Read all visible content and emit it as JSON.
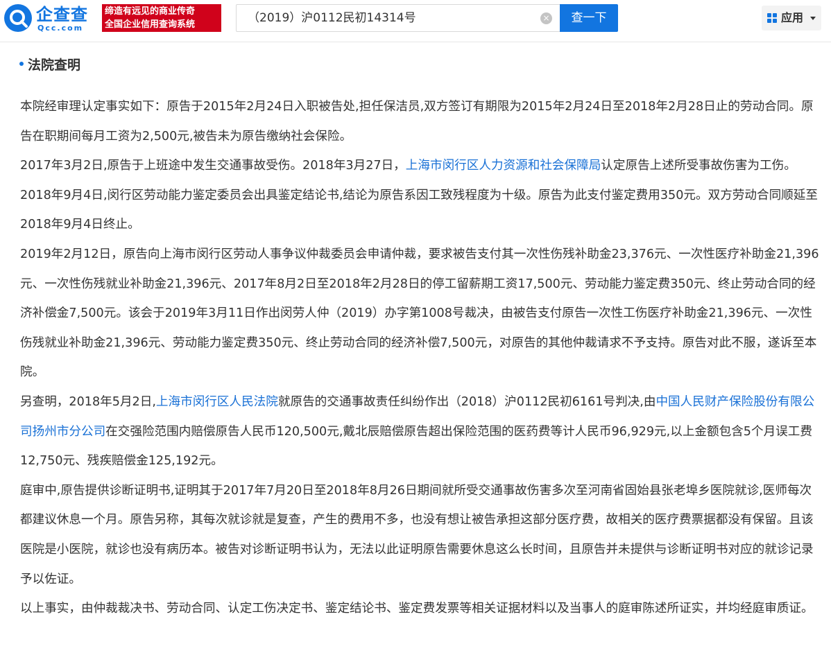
{
  "header": {
    "logo_text": "企查查",
    "logo_subtext": "Qcc.com",
    "slogan_line1": "缔造有远见的商业传奇",
    "slogan_line2": "全国企业信用查询系统",
    "search_value": "（2019）沪0112民初14314号",
    "search_button": "查一下",
    "apps_label": "应用",
    "colors": {
      "brand_blue": "#1275e0",
      "slogan_red": "#d0021b",
      "link_blue": "#1a71d6"
    }
  },
  "section": {
    "title": "法院查明"
  },
  "paragraphs": [
    {
      "segments": [
        {
          "text": "本院经审理认定事实如下：原告于2015年2月24日入职被告处,担任保洁员,双方签订有期限为2015年2月24日至2018年2月28日止的劳动合同。原告在职期间每月工资为2,500元,被告未为原告缴纳社会保险。",
          "link": false
        }
      ]
    },
    {
      "segments": [
        {
          "text": "2017年3月2日,原告于上班途中发生交通事故受伤。2018年3月27日，",
          "link": false
        },
        {
          "text": "上海市闵行区人力资源和社会保障局",
          "link": true
        },
        {
          "text": "认定原告上述所受事故伤害为工伤。2018年9月4日,闵行区劳动能力鉴定委员会出具鉴定结论书,结论为原告系因工致残程度为十级。原告为此支付鉴定费用350元。双方劳动合同顺延至2018年9月4日终止。",
          "link": false
        }
      ]
    },
    {
      "segments": [
        {
          "text": "2019年2月12日，原告向上海市闵行区劳动人事争议仲裁委员会申请仲裁，要求被告支付其一次性伤残补助金23,376元、一次性医疗补助金21,396元、一次性伤残就业补助金21,396元、2017年8月2日至2018年2月28日的停工留薪期工资17,500元、劳动能力鉴定费350元、终止劳动合同的经济补偿金7,500元。该会于2019年3月11日作出闵劳人仲（2019）办字第1008号裁决，由被告支付原告一次性工伤医疗补助金21,396元、一次性伤残就业补助金21,396元、劳动能力鉴定费350元、终止劳动合同的经济补偿7,500元，对原告的其他仲裁请求不予支持。原告对此不服，遂诉至本院。",
          "link": false
        }
      ]
    },
    {
      "segments": [
        {
          "text": "另查明，2018年5月2日,",
          "link": false
        },
        {
          "text": "上海市闵行区人民法院",
          "link": true
        },
        {
          "text": "就原告的交通事故责任纠纷作出（2018）沪0112民初6161号判决,由",
          "link": false
        },
        {
          "text": "中国人民财产保险股份有限公司扬州市分公司",
          "link": true
        },
        {
          "text": "在交强险范围内赔偿原告人民币120,500元,戴北辰赔偿原告超出保险范围的医药费等计人民币96,929元,以上金额包含5个月误工费12,750元、残疾赔偿金125,192元。",
          "link": false
        }
      ]
    },
    {
      "segments": [
        {
          "text": "庭审中,原告提供诊断证明书,证明其于2017年7月20日至2018年8月26日期间就所受交通事故伤害多次至河南省固始县张老埠乡医院就诊,医师每次都建议休息一个月。原告另称，其每次就诊就是复查，产生的费用不多，也没有想让被告承担这部分医疗费，故相关的医疗费票据都没有保留。且该医院是小医院，就诊也没有病历本。被告对诊断证明书认为，无法以此证明原告需要休息这么长时间，且原告并未提供与诊断证明书对应的就诊记录予以佐证。",
          "link": false
        }
      ]
    },
    {
      "segments": [
        {
          "text": "以上事实，由仲裁裁决书、劳动合同、认定工伤决定书、鉴定结论书、鉴定费发票等相关证据材料以及当事人的庭审陈述所证实，并均经庭审质证。",
          "link": false
        }
      ]
    }
  ]
}
